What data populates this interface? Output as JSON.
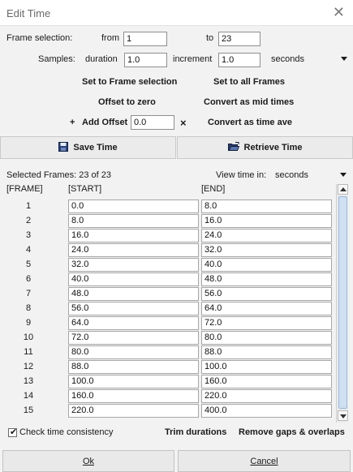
{
  "window": {
    "title": "Edit Time"
  },
  "frame_selection": {
    "label": "Frame selection:",
    "from_label": "from",
    "from_value": "1",
    "to_label": "to",
    "to_value": "23"
  },
  "samples": {
    "label": "Samples:",
    "duration_label": "duration",
    "duration_value": "1.0",
    "increment_label": "increment",
    "increment_value": "1.0",
    "unit": "seconds"
  },
  "actions": {
    "set_to_frame_selection": "Set to Frame selection",
    "set_to_all_frames": "Set to all Frames",
    "offset_to_zero": "Offset to zero",
    "convert_as_mid_times": "Convert as mid times",
    "add_offset_plus": "+",
    "add_offset_label": "Add Offset",
    "add_offset_value": "0.0",
    "add_offset_clear": "×",
    "convert_as_time_ave": "Convert as time ave"
  },
  "buttons": {
    "save_time": "Save Time",
    "retrieve_time": "Retrieve Time",
    "ok": "Ok",
    "cancel": "Cancel"
  },
  "status": {
    "selected_frames": "Selected Frames: 23 of 23",
    "view_time_label": "View time in:",
    "view_time_value": "seconds"
  },
  "table": {
    "headers": [
      "[FRAME]",
      "[START]",
      "[END]"
    ],
    "rows": [
      {
        "frame": "1",
        "start": "0.0",
        "end": "8.0"
      },
      {
        "frame": "2",
        "start": "8.0",
        "end": "16.0"
      },
      {
        "frame": "3",
        "start": "16.0",
        "end": "24.0"
      },
      {
        "frame": "4",
        "start": "24.0",
        "end": "32.0"
      },
      {
        "frame": "5",
        "start": "32.0",
        "end": "40.0"
      },
      {
        "frame": "6",
        "start": "40.0",
        "end": "48.0"
      },
      {
        "frame": "7",
        "start": "48.0",
        "end": "56.0"
      },
      {
        "frame": "8",
        "start": "56.0",
        "end": "64.0"
      },
      {
        "frame": "9",
        "start": "64.0",
        "end": "72.0"
      },
      {
        "frame": "10",
        "start": "72.0",
        "end": "80.0"
      },
      {
        "frame": "11",
        "start": "80.0",
        "end": "88.0"
      },
      {
        "frame": "12",
        "start": "88.0",
        "end": "100.0"
      },
      {
        "frame": "13",
        "start": "100.0",
        "end": "160.0"
      },
      {
        "frame": "14",
        "start": "160.0",
        "end": "220.0"
      },
      {
        "frame": "15",
        "start": "220.0",
        "end": "400.0"
      }
    ]
  },
  "bottom": {
    "check_time_consistency": "Check time consistency",
    "check_time_consistency_checked": true,
    "trim_durations": "Trim durations",
    "remove_gaps_overlaps": "Remove gaps & overlaps"
  },
  "colors": {
    "accent": "#cfe0f3",
    "background": "#f2f2f2"
  }
}
